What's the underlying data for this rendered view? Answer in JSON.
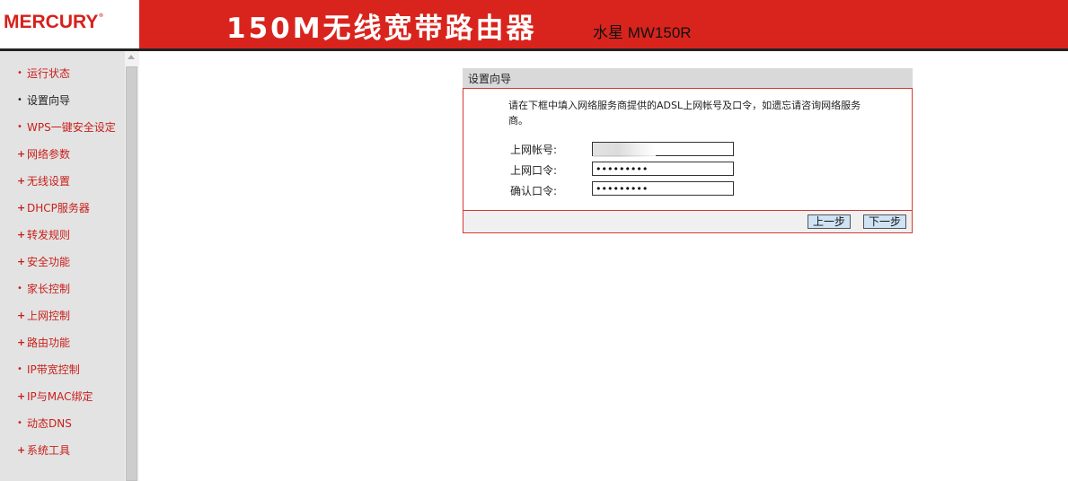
{
  "header": {
    "logo": "MERCURY",
    "logo_mark": "®",
    "title": "150M无线宽带路由器",
    "model": "水星 MW150R"
  },
  "sidebar": {
    "items": [
      {
        "label": "运行状态",
        "bullet": "•",
        "active": false
      },
      {
        "label": "设置向导",
        "bullet": "•",
        "active": true
      },
      {
        "label": "WPS一键安全设定",
        "bullet": "•",
        "active": false
      },
      {
        "label": "网络参数",
        "bullet": "+",
        "active": false
      },
      {
        "label": "无线设置",
        "bullet": "+",
        "active": false
      },
      {
        "label": "DHCP服务器",
        "bullet": "+",
        "active": false
      },
      {
        "label": "转发规则",
        "bullet": "+",
        "active": false
      },
      {
        "label": "安全功能",
        "bullet": "+",
        "active": false
      },
      {
        "label": "家长控制",
        "bullet": "•",
        "active": false
      },
      {
        "label": "上网控制",
        "bullet": "+",
        "active": false
      },
      {
        "label": "路由功能",
        "bullet": "+",
        "active": false
      },
      {
        "label": "IP带宽控制",
        "bullet": "•",
        "active": false
      },
      {
        "label": "IP与MAC绑定",
        "bullet": "+",
        "active": false
      },
      {
        "label": "动态DNS",
        "bullet": "•",
        "active": false
      },
      {
        "label": "系统工具",
        "bullet": "+",
        "active": false
      }
    ]
  },
  "wizard": {
    "title": "设置向导",
    "description": "请在下框中填入网络服务商提供的ADSL上网帐号及口令，如遗忘请咨询网络服务商。",
    "fields": {
      "account_label": "上网帐号:",
      "account_value": "",
      "password_label": "上网口令:",
      "password_value": "•••••••••",
      "confirm_label": "确认口令:",
      "confirm_value": "•••••••••"
    },
    "buttons": {
      "prev": "上一步",
      "next": "下一步"
    }
  },
  "colors": {
    "brand_red": "#d9241d",
    "sidebar_bg": "#e3e3e3",
    "link_red": "#c8201b"
  }
}
